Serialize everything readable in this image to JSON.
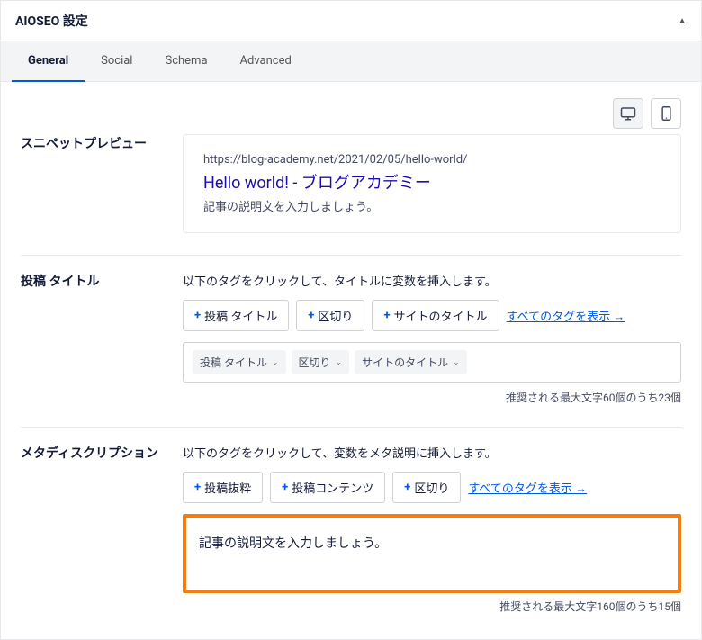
{
  "header": {
    "title": "AIOSEO 設定"
  },
  "tabs": [
    {
      "label": "General",
      "active": true
    },
    {
      "label": "Social",
      "active": false
    },
    {
      "label": "Schema",
      "active": false
    },
    {
      "label": "Advanced",
      "active": false
    }
  ],
  "snippet": {
    "label": "スニペットプレビュー",
    "url": "https://blog-academy.net/2021/02/05/hello-world/",
    "title": "Hello world! - ブログアカデミー",
    "description": "記事の説明文を入力しましょう。"
  },
  "post_title": {
    "label": "投稿 タイトル",
    "helper": "以下のタグをクリックして、タイトルに変数を挿入します。",
    "tag_buttons": [
      "投稿 タイトル",
      "区切り",
      "サイトのタイトル"
    ],
    "view_all": "すべてのタグを表示 →",
    "chips": [
      "投稿 タイトル",
      "区切り",
      "サイトのタイトル"
    ],
    "counter": "推奨される最大文字60個のうち23個"
  },
  "meta_desc": {
    "label": "メタディスクリプション",
    "helper": "以下のタグをクリックして、変数をメタ説明に挿入します。",
    "tag_buttons": [
      "投稿抜粋",
      "投稿コンテンツ",
      "区切り"
    ],
    "view_all": "すべてのタグを表示 →",
    "value": "記事の説明文を入力しましょう。",
    "counter": "推奨される最大文字160個のうち15個"
  }
}
